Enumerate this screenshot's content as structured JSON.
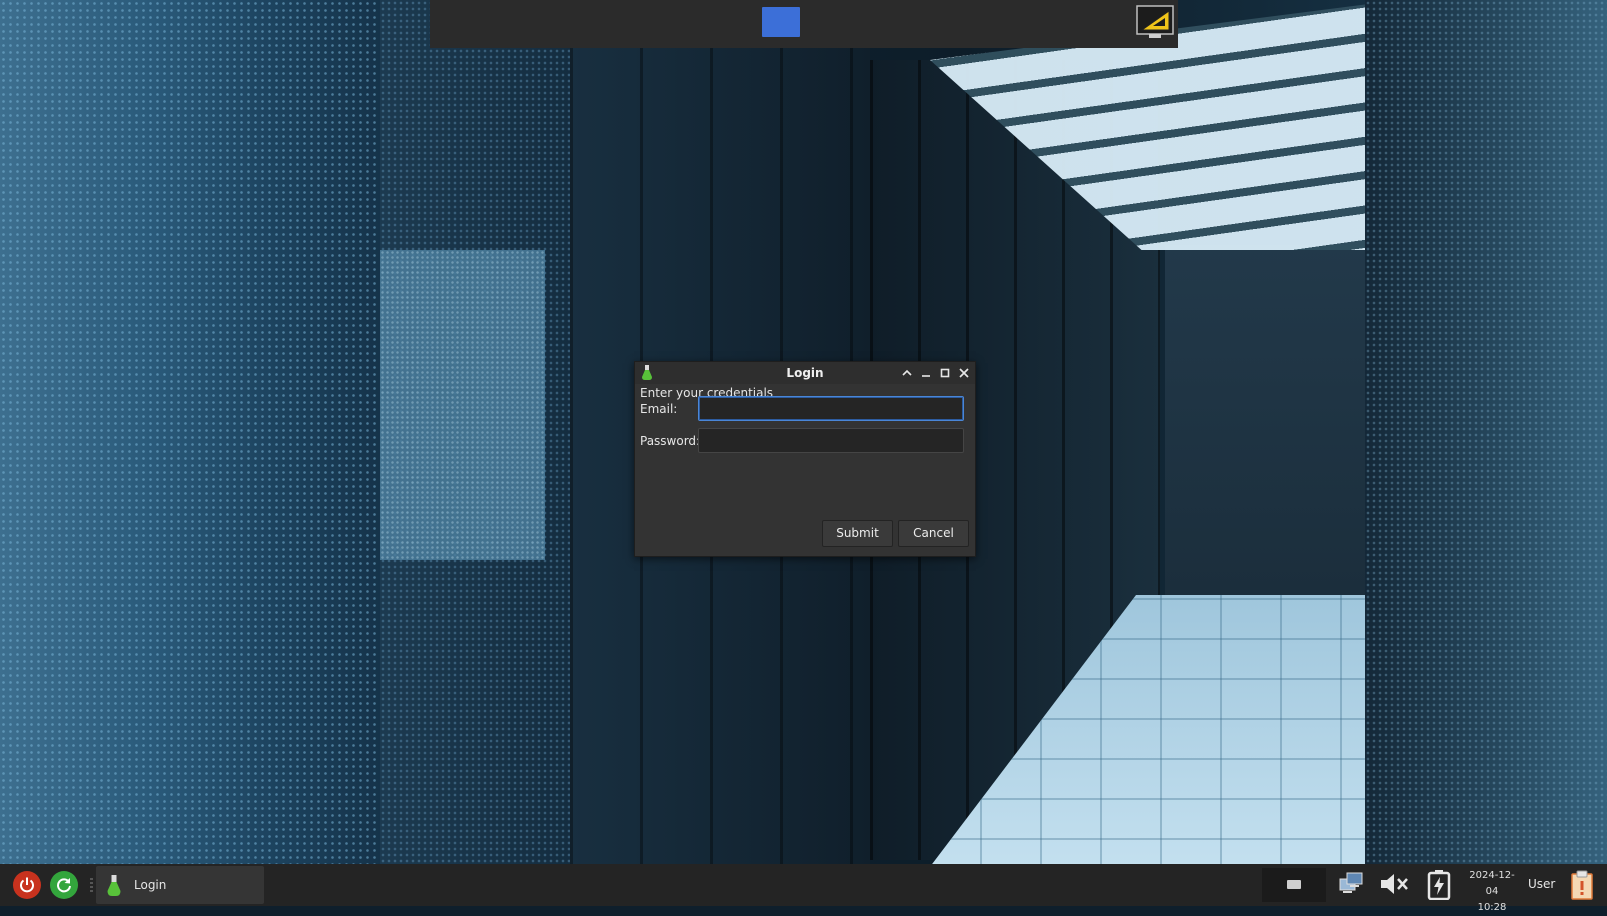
{
  "dialog": {
    "title": "Login",
    "prompt": "Enter your credentials",
    "email_label": "Email:",
    "email_value": "",
    "password_label": "Password:",
    "password_value": "",
    "submit_label": "Submit",
    "cancel_label": "Cancel",
    "title_buttons": [
      "chevron-up-icon",
      "minimize-icon",
      "maximize-icon",
      "close-icon"
    ]
  },
  "top_panel": {
    "workspace_label": "",
    "app_icon": "triangle-app-icon"
  },
  "taskbar": {
    "left_buttons": [
      "power-icon",
      "restart-icon"
    ],
    "tasks": [
      {
        "label": "Login",
        "icon": "flask-icon"
      }
    ],
    "tray_icons": [
      "keyboard-icon",
      "network-icon",
      "volume-muted-icon",
      "battery-charging-icon",
      "clipboard-icon"
    ],
    "date": "2024-12-04",
    "time": "10:28",
    "user": "User"
  },
  "colors": {
    "panel": "#2b2b2b",
    "dialog_bg": "#333333",
    "focus_border": "#4a86d6",
    "workspace_active": "#3c6fd8",
    "power": "#c8321e",
    "restart": "#33a53c"
  }
}
